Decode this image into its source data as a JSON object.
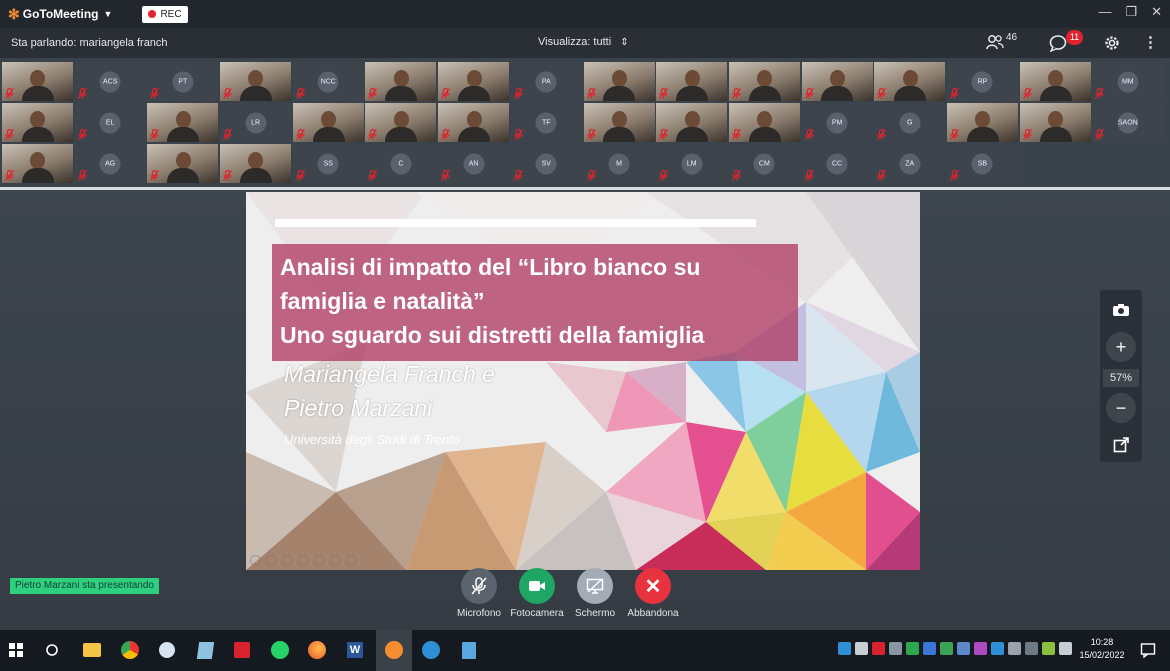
{
  "app": {
    "brand": "GoToMeeting",
    "rec_label": "REC"
  },
  "subbar": {
    "speaking": "Sta parlando: mariangela franch",
    "view_label": "Visualizza: tutti",
    "participants_count": "46",
    "chat_badge": "11"
  },
  "grid": {
    "tiles": [
      {
        "type": "video",
        "initials": ""
      },
      {
        "type": "initials",
        "initials": "ACS"
      },
      {
        "type": "initials",
        "initials": "PT"
      },
      {
        "type": "video",
        "initials": ""
      },
      {
        "type": "initials",
        "initials": "NCC"
      },
      {
        "type": "video",
        "initials": ""
      },
      {
        "type": "video",
        "initials": ""
      },
      {
        "type": "initials",
        "initials": "PA"
      },
      {
        "type": "video",
        "initials": ""
      },
      {
        "type": "video",
        "initials": ""
      },
      {
        "type": "video",
        "initials": ""
      },
      {
        "type": "video",
        "initials": ""
      },
      {
        "type": "video",
        "initials": ""
      },
      {
        "type": "initials",
        "initials": "RP"
      },
      {
        "type": "video",
        "initials": ""
      },
      {
        "type": "initials",
        "initials": "MM"
      },
      {
        "type": "video",
        "initials": ""
      },
      {
        "type": "initials",
        "initials": "EL"
      },
      {
        "type": "video",
        "initials": ""
      },
      {
        "type": "initials",
        "initials": "LR"
      },
      {
        "type": "video",
        "initials": ""
      },
      {
        "type": "video",
        "initials": ""
      },
      {
        "type": "video",
        "initials": ""
      },
      {
        "type": "initials",
        "initials": "TF"
      },
      {
        "type": "video",
        "initials": ""
      },
      {
        "type": "video",
        "initials": ""
      },
      {
        "type": "video",
        "initials": ""
      },
      {
        "type": "initials",
        "initials": "PM"
      },
      {
        "type": "initials",
        "initials": "G"
      },
      {
        "type": "video",
        "initials": ""
      },
      {
        "type": "video",
        "initials": ""
      },
      {
        "type": "initials",
        "initials": "SAON"
      },
      {
        "type": "video",
        "initials": ""
      },
      {
        "type": "initials",
        "initials": "AG"
      },
      {
        "type": "video",
        "initials": ""
      },
      {
        "type": "video",
        "initials": ""
      },
      {
        "type": "initials",
        "initials": "SS"
      },
      {
        "type": "initials",
        "initials": "C"
      },
      {
        "type": "initials",
        "initials": "AN"
      },
      {
        "type": "initials",
        "initials": "SV"
      },
      {
        "type": "initials",
        "initials": "M"
      },
      {
        "type": "initials",
        "initials": "LM"
      },
      {
        "type": "initials",
        "initials": "CM"
      },
      {
        "type": "initials",
        "initials": "CC"
      },
      {
        "type": "initials",
        "initials": "ZA"
      },
      {
        "type": "initials",
        "initials": "SB"
      }
    ]
  },
  "slide": {
    "title_line1": "Analisi di impatto del “Libro bianco su",
    "title_line2": "famiglia e natalità”",
    "title_line3": "Uno sguardo sui distretti della famiglia",
    "author_line1": "Mariangela Franch e",
    "author_line2": "Pietro Marzani",
    "university": "Università degli Studi di Trento"
  },
  "zoom": {
    "level": "57%"
  },
  "presenting": "Pietro Marzani sta presentando",
  "controls": {
    "mic_label": "Microfono",
    "camera_label": "Fotocamera",
    "screen_label": "Schermo",
    "leave_label": "Abbandona"
  },
  "taskbar": {
    "time": "10:28",
    "date": "15/02/2022"
  },
  "colors": {
    "accent_green": "#2ecf7e",
    "camera_green": "#1fa564",
    "leave_red": "#e8333f",
    "rec_red": "#e0232d",
    "brand_orange": "#f68d2e"
  }
}
